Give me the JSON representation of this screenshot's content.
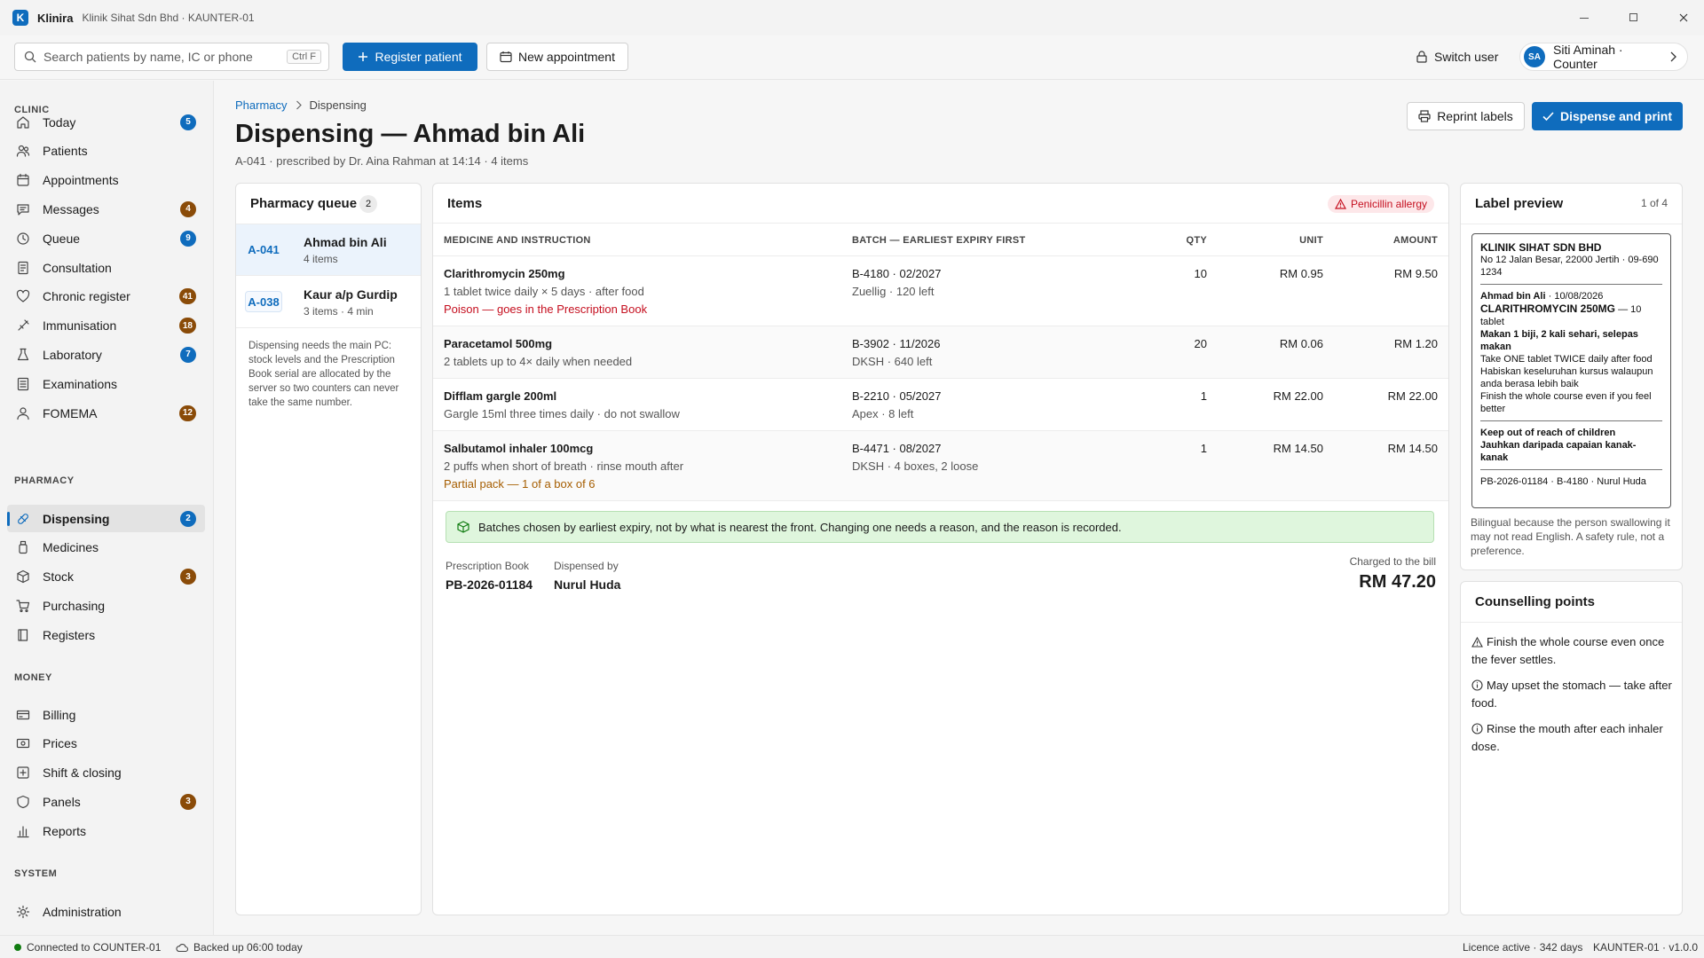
{
  "titlebar": {
    "app_name": "Klinira",
    "subtitle": "Klinik Sihat Sdn Bhd · KAUNTER-01",
    "logo_letter": "K"
  },
  "toolbar": {
    "search_placeholder": "Search patients by name, IC or phone",
    "search_shortcut": "Ctrl F",
    "register_label": "Register patient",
    "appointment_label": "New appointment",
    "switch_user_label": "Switch user",
    "user_initials": "SA",
    "user_name": "Siti Aminah · Counter"
  },
  "sidebar": {
    "clinic_heading": "CLINIC",
    "clinic": [
      {
        "label": "Today",
        "badge": "5"
      },
      {
        "label": "Patients",
        "badge": ""
      },
      {
        "label": "Appointments",
        "badge": ""
      },
      {
        "label": "Messages",
        "badge": "4"
      },
      {
        "label": "Queue",
        "badge": "9"
      },
      {
        "label": "Consultation",
        "badge": ""
      },
      {
        "label": "Chronic register",
        "badge": "41"
      },
      {
        "label": "Immunisation",
        "badge": "18"
      },
      {
        "label": "Laboratory",
        "badge": "7"
      },
      {
        "label": "Examinations",
        "badge": ""
      },
      {
        "label": "FOMEMA",
        "badge": "12"
      }
    ],
    "pharmacy_heading": "PHARMACY",
    "pharmacy": [
      {
        "label": "Dispensing",
        "badge": "2"
      },
      {
        "label": "Medicines",
        "badge": ""
      },
      {
        "label": "Stock",
        "badge": "3"
      },
      {
        "label": "Purchasing",
        "badge": ""
      },
      {
        "label": "Registers",
        "badge": ""
      }
    ],
    "money_heading": "MONEY",
    "money": [
      {
        "label": "Billing",
        "badge": ""
      },
      {
        "label": "Prices",
        "badge": ""
      },
      {
        "label": "Shift & closing",
        "badge": ""
      },
      {
        "label": "Panels",
        "badge": "3"
      },
      {
        "label": "Reports",
        "badge": ""
      }
    ],
    "system_heading": "SYSTEM",
    "system": [
      {
        "label": "Administration",
        "badge": ""
      }
    ]
  },
  "breadcrumb": {
    "parent": "Pharmacy",
    "current": "Dispensing"
  },
  "page": {
    "title": "Dispensing — Ahmad bin Ali",
    "subtitle": "A-041 · prescribed by Dr. Aina Rahman at 14:14 · 4 items",
    "reprint_label": "Reprint labels",
    "dispense_label": "Dispense and print"
  },
  "queue": {
    "title": "Pharmacy queue",
    "count": "2",
    "items": [
      {
        "id": "A-041",
        "name": "Ahmad bin Ali",
        "meta": "4 items"
      },
      {
        "id": "A-038",
        "name": "Kaur a/p Gurdip",
        "meta": "3 items · 4 min"
      }
    ],
    "note": "Dispensing needs the main PC: stock levels and the Prescription Book serial are allocated by the server so two counters can never take the same number."
  },
  "items": {
    "title": "Items",
    "allergy": "Penicillin allergy",
    "headers": {
      "medicine": "MEDICINE AND INSTRUCTION",
      "batch": "BATCH — EARLIEST EXPIRY FIRST",
      "qty": "QTY",
      "unit": "UNIT",
      "amount": "AMOUNT"
    },
    "rows": [
      {
        "name": "Clarithromycin 250mg",
        "instruction": "1 tablet twice daily × 5 days · after food",
        "warning": "Poison — goes in the Prescription Book",
        "batch": "B-4180 · 02/2027",
        "batch_sub": "Zuellig · 120 left",
        "qty": "10",
        "unit": "RM 0.95",
        "amount": "RM 9.50"
      },
      {
        "name": "Paracetamol 500mg",
        "instruction": "2 tablets up to 4× daily when needed",
        "warning": "",
        "batch": "B-3902 · 11/2026",
        "batch_sub": "DKSH · 640 left",
        "qty": "20",
        "unit": "RM 0.06",
        "amount": "RM 1.20"
      },
      {
        "name": "Difflam gargle 200ml",
        "instruction": "Gargle 15ml three times daily · do not swallow",
        "warning": "",
        "batch": "B-2210 · 05/2027",
        "batch_sub": "Apex · 8 left",
        "qty": "1",
        "unit": "RM 22.00",
        "amount": "RM 22.00"
      },
      {
        "name": "Salbutamol inhaler 100mcg",
        "instruction": "2 puffs when short of breath · rinse mouth after",
        "warning": "Partial pack — 1 of a box of 6",
        "batch": "B-4471 · 08/2027",
        "batch_sub": "DKSH · 4 boxes, 2 loose",
        "qty": "1",
        "unit": "RM 14.50",
        "amount": "RM 14.50"
      }
    ],
    "notice": "Batches chosen by earliest expiry, not by what is nearest the front. Changing one needs a reason, and the reason is recorded.",
    "prescription_book_label": "Prescription Book",
    "prescription_book_value": "PB-2026-01184",
    "dispensed_by_label": "Dispensed by",
    "dispensed_by_value": "Nurul Huda",
    "charged_label": "Charged to the bill",
    "charged_value": "RM 47.20"
  },
  "label_preview": {
    "title": "Label preview",
    "pager": "1 of 4",
    "clinic_name": "KLINIK SIHAT SDN BHD",
    "clinic_address": "No 12 Jalan Besar, 22000 Jertih · 09-690 1234",
    "patient_line": "Ahmad bin Ali",
    "date": " · 10/08/2026",
    "drug": "CLARITHROMYCIN 250MG",
    "drug_qty": " — 10 tablet",
    "malay_dose": "Makan 1 biji, 2 kali sehari, selepas makan",
    "english_dose": "Take ONE tablet TWICE daily after food",
    "malay_course": "Habiskan keseluruhan kursus walaupun anda berasa lebih baik",
    "english_course": "Finish the whole course even if you feel better",
    "warning_en": "Keep out of reach of children",
    "warning_ms": "Jauhkan daripada capaian kanak-kanak",
    "footer": "PB-2026-01184 · B-4180 · Nurul Huda",
    "note": "Bilingual because the person swallowing it may not read English. A safety rule, not a preference."
  },
  "counselling": {
    "title": "Counselling points",
    "points": [
      {
        "icon": "warning-icon",
        "text": "Finish the whole course even once the fever settles."
      },
      {
        "icon": "info-icon",
        "text": "May upset the stomach — take after food."
      },
      {
        "icon": "info-icon",
        "text": "Rinse the mouth after each inhaler dose."
      }
    ]
  },
  "status": {
    "connection": "Connected to COUNTER-01",
    "backup": "Backed up 06:00 today",
    "licence": "Licence active · 342 days",
    "version": "KAUNTER-01 · v1.0.0"
  },
  "colors": {
    "accent": "#0f6cbd",
    "danger": "#c50f1f",
    "warning_badge": "#8a4b08",
    "success_bg": "#dff6dd"
  }
}
